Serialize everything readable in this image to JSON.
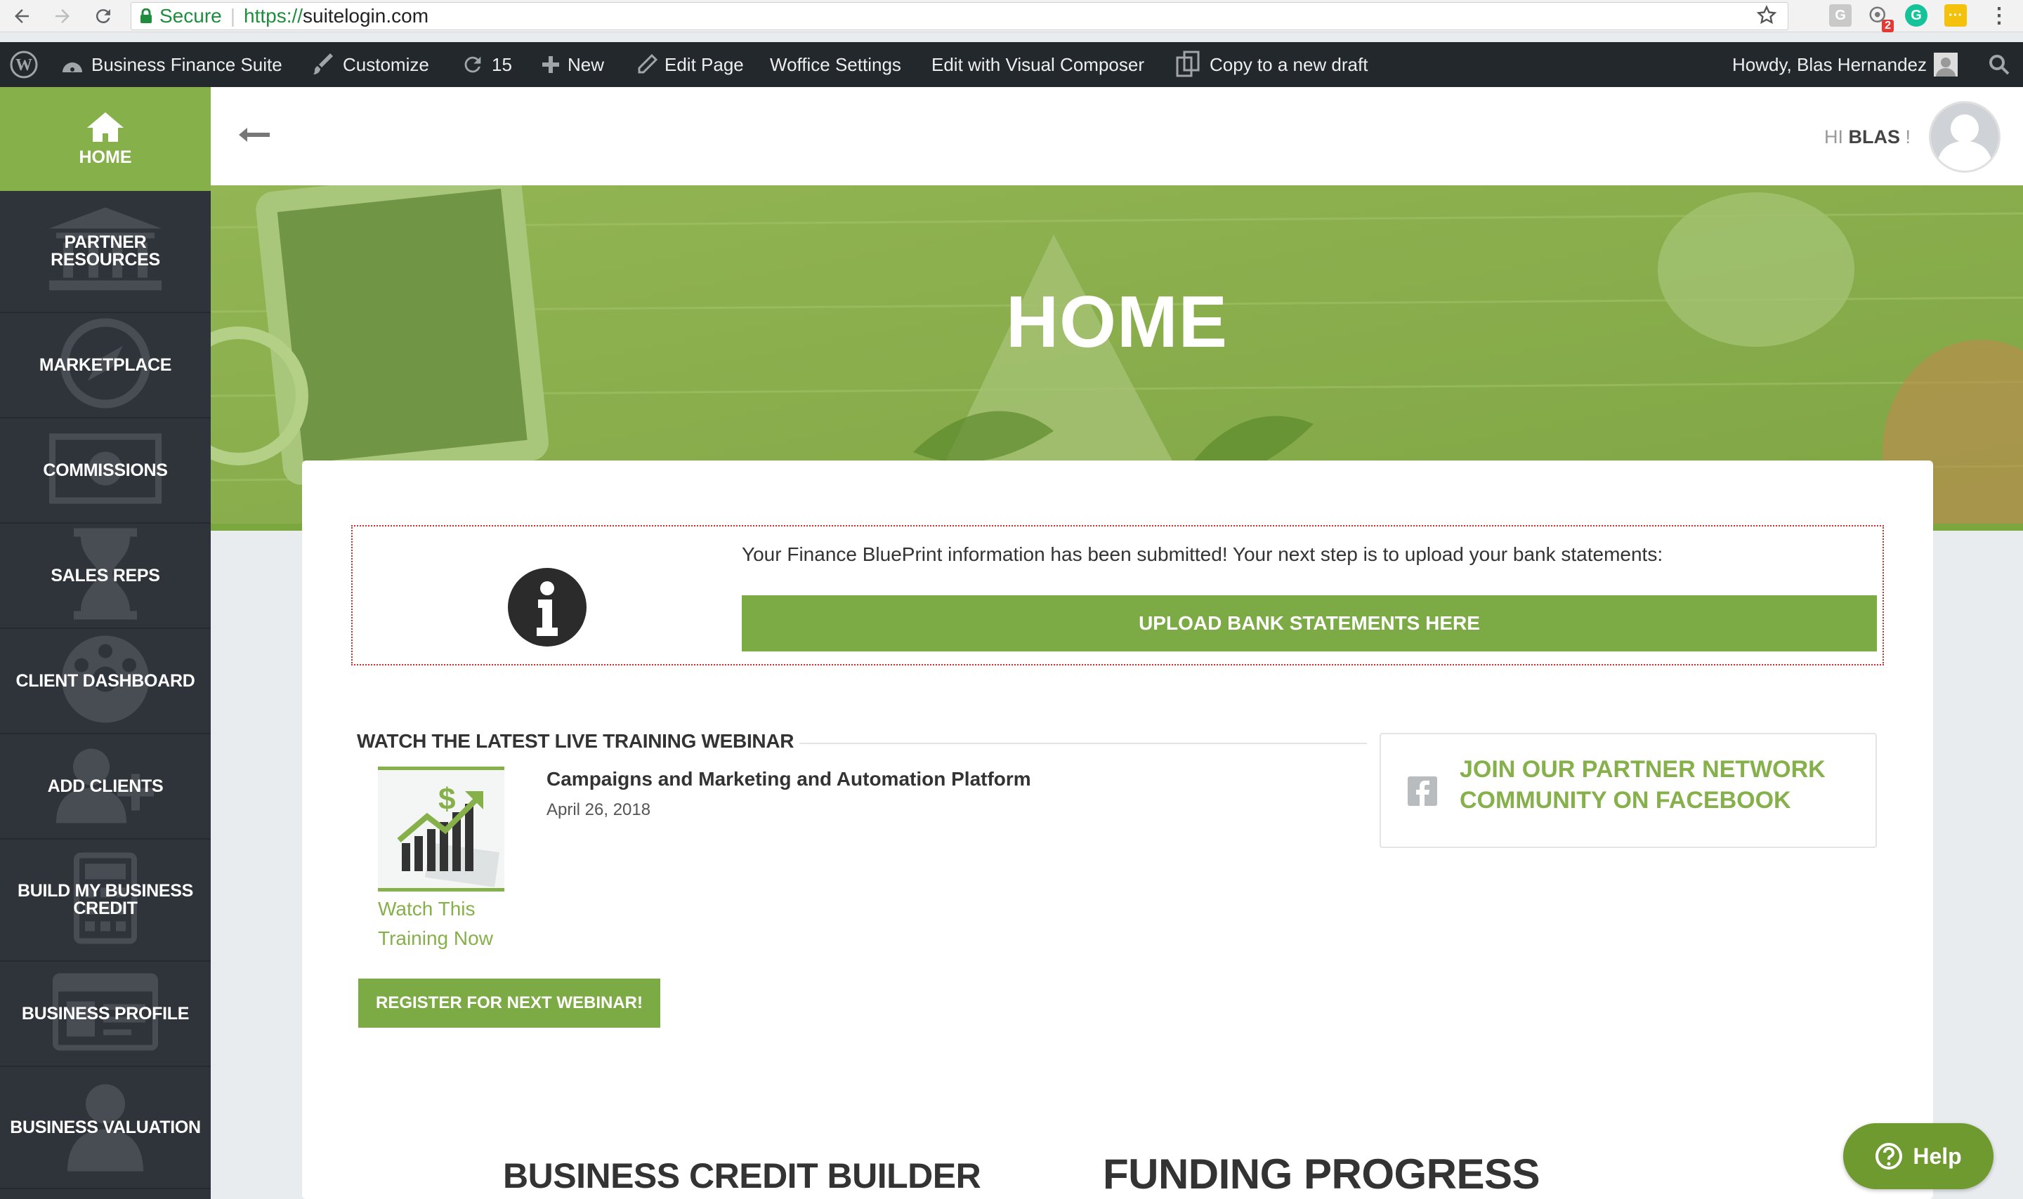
{
  "browser": {
    "secure_label": "Secure",
    "url_scheme": "https://",
    "url_host": "suitelogin.com",
    "ext_badge": "2"
  },
  "adminbar": {
    "site_name": "Business Finance Suite",
    "customize": "Customize",
    "updates_count": "15",
    "new": "New",
    "edit_page": "Edit Page",
    "woffice_settings": "Woffice Settings",
    "visual_composer": "Edit with Visual Composer",
    "copy_draft": "Copy to a new draft",
    "howdy": "Howdy, Blas Hernandez"
  },
  "sidebar": {
    "home": "HOME",
    "items": [
      {
        "label": "PARTNER RESOURCES",
        "icon": "bank-icon"
      },
      {
        "label": "MARKETPLACE",
        "icon": "compass-icon"
      },
      {
        "label": "COMMISSIONS",
        "icon": "money-icon"
      },
      {
        "label": "SALES REPS",
        "icon": "hourglass-icon"
      },
      {
        "label": "CLIENT DASHBOARD",
        "icon": "dashboard-icon"
      },
      {
        "label": "ADD CLIENTS",
        "icon": "add-user-icon"
      },
      {
        "label": "BUILD MY BUSINESS CREDIT",
        "icon": "calculator-icon"
      },
      {
        "label": "BUSINESS PROFILE",
        "icon": "profile-card-icon"
      },
      {
        "label": "BUSINESS VALUATION",
        "icon": "person-icon"
      }
    ]
  },
  "header": {
    "greeting": "HI",
    "user": "BLAS",
    "exclaim": "!"
  },
  "hero": {
    "title": "HOME"
  },
  "alert": {
    "message": "Your Finance BluePrint information has been submitted! Your next step is to upload your bank statements:",
    "button": "UPLOAD BANK STATEMENTS HERE"
  },
  "webinar": {
    "heading": "WATCH THE LATEST LIVE TRAINING WEBINAR",
    "title": "Campaigns and Marketing and Automation Platform",
    "date": "April 26, 2018",
    "watch_link": "Watch This Training Now",
    "register_button": "REGISTER FOR NEXT WEBINAR!"
  },
  "facebook": {
    "text": "JOIN OUR PARTNER NETWORK COMMUNITY ON FACEBOOK"
  },
  "sections": {
    "credit_builder": "BUSINESS CREDIT BUILDER",
    "funding_progress": "FUNDING PROGRESS"
  },
  "help": {
    "label": "Help"
  },
  "colors": {
    "brand_green": "#86b04a",
    "sidebar_dark": "#2f343b",
    "wp_bar": "#23282d"
  }
}
